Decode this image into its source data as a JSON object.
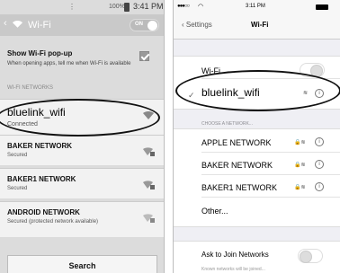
{
  "android": {
    "status_time": "3:41 PM",
    "battery_text": "100%",
    "title": "Wi-Fi",
    "toggle_label": "ON",
    "popup_title": "Show Wi-Fi pop-up",
    "popup_desc": "When opening apps, tell me when Wi-Fi is available",
    "section": "WI-FI NETWORKS",
    "networks": [
      {
        "name": "bluelink_wifi",
        "status": "Connected"
      },
      {
        "name": "BAKER NETWORK",
        "status": "Secured"
      },
      {
        "name": "BAKER1 NETWORK",
        "status": "Secured"
      },
      {
        "name": "ANDROID NETWORK",
        "status": "Secured (protected network available)"
      }
    ],
    "search_label": "Search"
  },
  "ios": {
    "status_time": "3:11 PM",
    "back_label": "Settings",
    "title": "Wi-Fi",
    "wifi_label": "Wi-Fi",
    "connected_name": "bluelink_wifi",
    "choose_label": "CHOOSE A NETWORK...",
    "networks": [
      "APPLE NETWORK",
      "BAKER NETWORK",
      "BAKER1 NETWORK"
    ],
    "other_label": "Other...",
    "join_label": "Ask to Join Networks",
    "join_hint": "Known networks will be joined..."
  },
  "icons": {
    "wifi": "wifi-icon",
    "info": "info-icon",
    "lock": "lock-icon",
    "check": "checkmark-icon"
  }
}
